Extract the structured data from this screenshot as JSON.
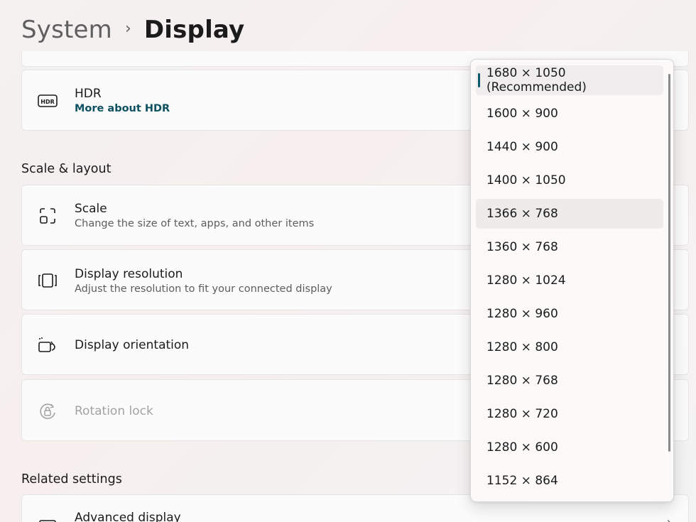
{
  "breadcrumb": {
    "parent": "System",
    "separator": "›",
    "current": "Display"
  },
  "hdr": {
    "icon": "hdr-icon",
    "title": "HDR",
    "link": "More about HDR"
  },
  "scale_layout": {
    "heading": "Scale & layout",
    "scale": {
      "icon": "scale-icon",
      "title": "Scale",
      "subtitle": "Change the size of text, apps, and other items"
    },
    "resolution": {
      "icon": "display-resolution-icon",
      "title": "Display resolution",
      "subtitle": "Adjust the resolution to fit your connected display"
    },
    "orientation": {
      "icon": "display-orientation-icon",
      "title": "Display orientation"
    },
    "rotation_lock": {
      "icon": "rotation-lock-icon",
      "title": "Rotation lock"
    }
  },
  "related": {
    "heading": "Related settings",
    "advanced_display": {
      "icon": "monitor-icon",
      "title": "Advanced display"
    }
  },
  "resolution_dropdown": {
    "selected_index": 0,
    "hovered_index": 4,
    "options": [
      "1680 × 1050 (Recommended)",
      "1600 × 900",
      "1440 × 900",
      "1400 × 1050",
      "1366 × 768",
      "1360 × 768",
      "1280 × 1024",
      "1280 × 960",
      "1280 × 800",
      "1280 × 768",
      "1280 × 720",
      "1280 × 600",
      "1152 × 864"
    ]
  },
  "colors": {
    "accent": "#0f5a6a",
    "link": "#0e5160"
  }
}
